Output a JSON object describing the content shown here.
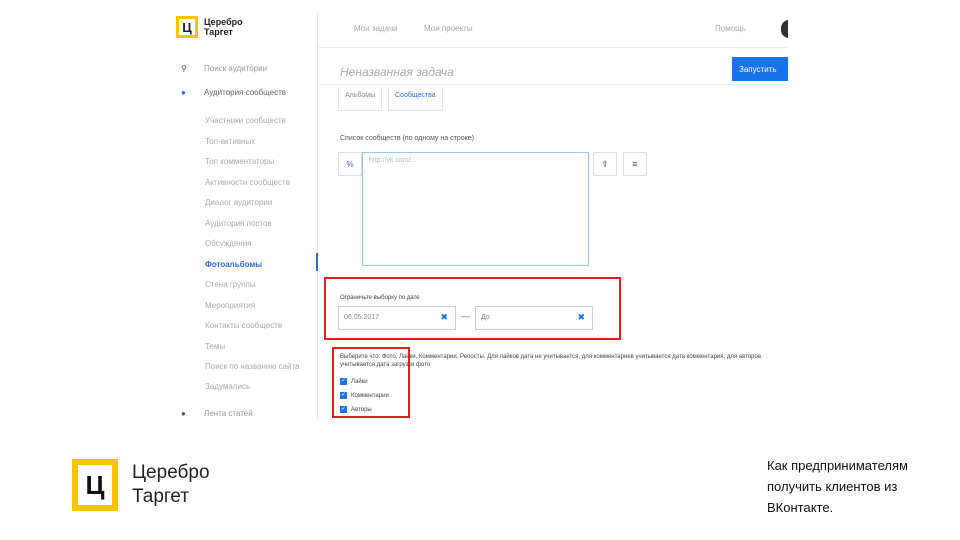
{
  "brand": {
    "mark": "Ц",
    "line1": "Церебро",
    "line2": "Таргет"
  },
  "topnav": {
    "my_tasks": "Мои задачи",
    "my_projects": "Мои проекты",
    "help": "Помощь"
  },
  "sidebar": {
    "main_items": [
      {
        "label": "Поиск аудитории",
        "icon": "search-icon",
        "glyph": "⚲"
      },
      {
        "label": "Аудитория сообществ",
        "icon": "users-icon",
        "glyph": "●"
      }
    ],
    "sub_items": [
      "Участники сообществ",
      "Топ-активных",
      "Топ комментаторы",
      "Активности сообществ",
      "Диалог аудитории",
      "Аудитория постов",
      "Обсуждения",
      "Фотоальбомы",
      "Стена группы",
      "Мероприятия",
      "Контакты сообществ",
      "Темы",
      "Поиск по названию сайта",
      "Задумались"
    ],
    "active_index": 7,
    "bottom_item": {
      "label": "Лента статей",
      "icon": "chat-icon",
      "glyph": "●"
    }
  },
  "task": {
    "title": "Неназванная задача",
    "run_label": "Запустить",
    "tabs": [
      "Альбомы",
      "Сообщества"
    ]
  },
  "communities": {
    "label": "Список сообществ (по одному на строке)",
    "placeholder": "http://vk.com/...",
    "link_glyph": "%",
    "upload_glyph": "⇧",
    "list_glyph": "≡"
  },
  "date_filter": {
    "label": "Ограничьте выборку по дате",
    "from": "06.05.2017",
    "to_placeholder": "До",
    "dash": "—",
    "clear_glyph": "✖"
  },
  "choose": {
    "text": "Выберите что: Фото, Лайки, Комментарии, Репосты. Для лайков дата не учитывается, для комментариев учитывается дата комментария, для авторов учитывается дата загрузки фото",
    "options": [
      {
        "label": "Лайки",
        "checked": true
      },
      {
        "label": "Комментарии",
        "checked": true
      },
      {
        "label": "Авторы",
        "checked": true
      }
    ],
    "check_glyph": "✓"
  },
  "footer": {
    "caption_lines": [
      "Как предпринимателям",
      "получить клиентов из",
      "ВКонтакте."
    ]
  },
  "colors": {
    "accent": "#1a73e8",
    "brand_yellow": "#f7c500",
    "highlight": "#e02020"
  }
}
